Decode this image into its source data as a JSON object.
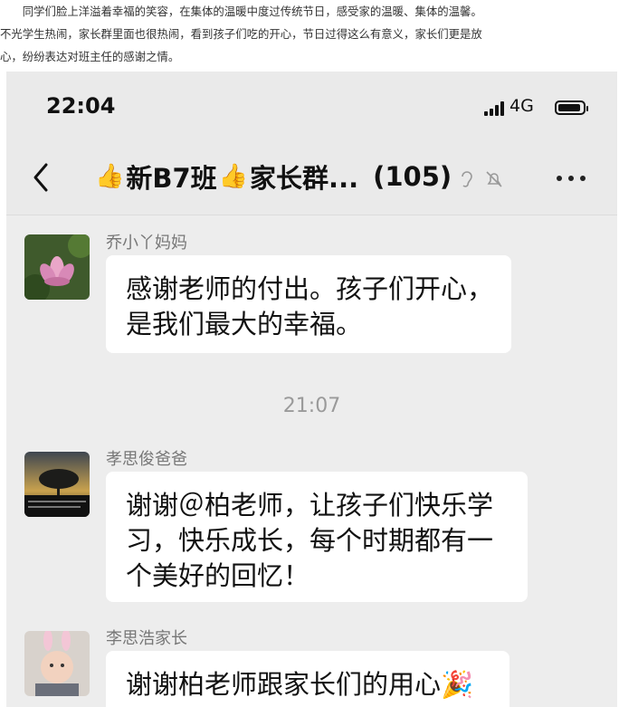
{
  "article": {
    "lines": [
      "　　同学们脸上洋溢着幸福的笑容，在集体的温暖中度过传统节日，感受家的温暖、集体的温馨。",
      "不光学生热闹，家长群里面也很热闹，看到孩子们吃的开心，节日过得这么有意义，家长们更是放",
      "心，纷纷表达对班主任的感谢之情。"
    ]
  },
  "status_bar": {
    "time": "22:04",
    "network": "4G"
  },
  "nav": {
    "title_prefix": "新B7班",
    "title_suffix": "家长群...",
    "member_count": "(105)",
    "thumb_emoji": "👍"
  },
  "messages": [
    {
      "sender": "乔小丫妈妈",
      "lines": [
        "感谢老师的付出。孩子们开心，",
        "是我们最大的幸福。"
      ]
    },
    {
      "sender": "孝思俊爸爸",
      "lines": [
        "谢谢＠柏老师，让孩子们快乐学",
        "习，快乐成长，每个时期都有一",
        "个美好的回忆！"
      ]
    },
    {
      "sender": "李思浩家长",
      "lines": [
        "谢谢柏老师跟家长们的用心🎉"
      ]
    }
  ],
  "timestamp": "21:07",
  "colors": {
    "chat_bg": "#ededed",
    "bubble": "#ffffff",
    "nav_bg": "#eaeaea"
  }
}
